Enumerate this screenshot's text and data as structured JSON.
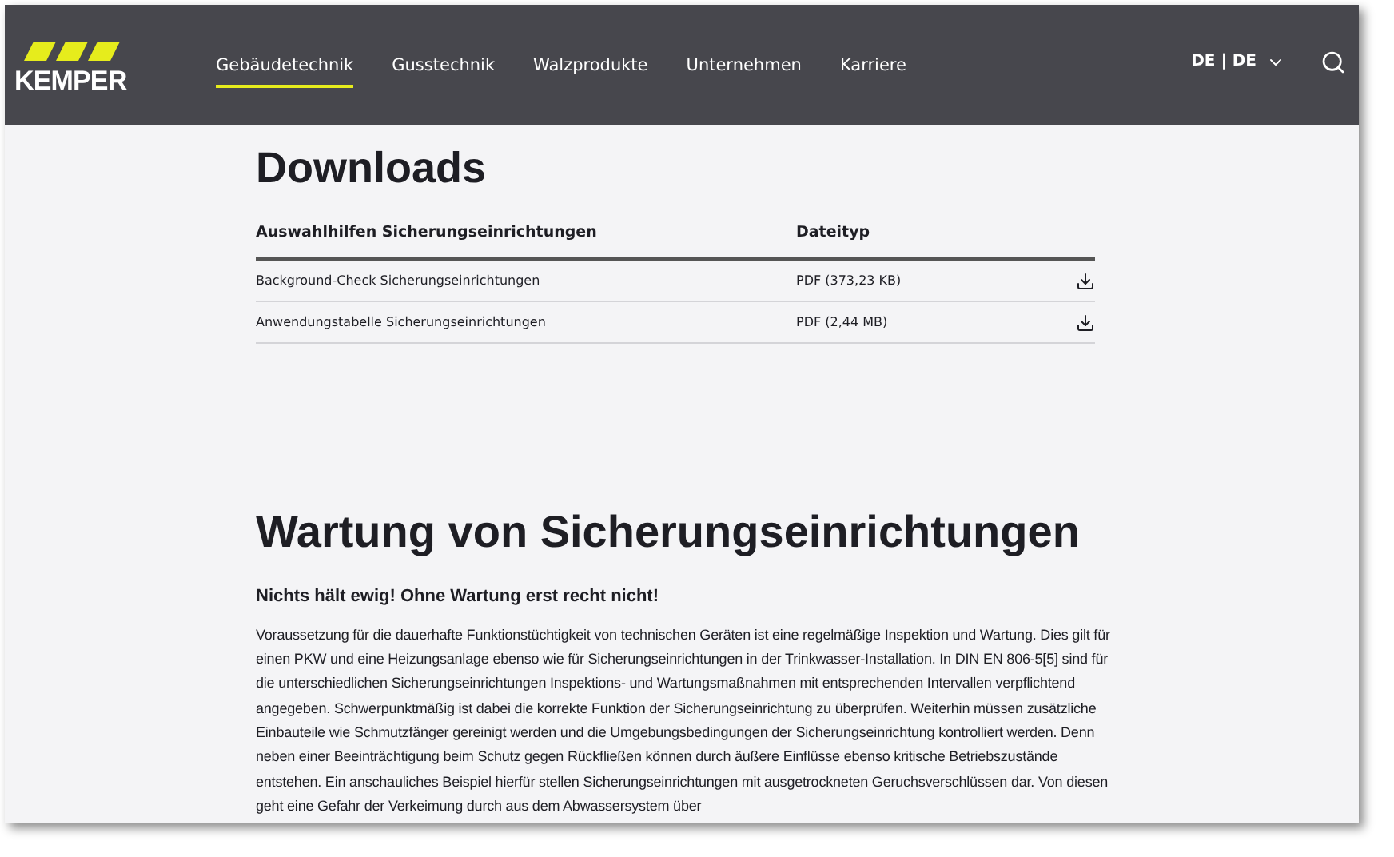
{
  "header": {
    "logo": "KEMPER",
    "nav": [
      {
        "label": "Gebäudetechnik",
        "selected": true
      },
      {
        "label": "Gusstechnik",
        "selected": false
      },
      {
        "label": "Walzprodukte",
        "selected": false
      },
      {
        "label": "Unternehmen",
        "selected": false
      },
      {
        "label": "Karriere",
        "selected": false
      }
    ],
    "language": "DE | DE"
  },
  "downloads": {
    "title": "Downloads",
    "columns": [
      "Auswahlhilfen Sicherungseinrichtungen",
      "Dateityp"
    ],
    "rows": [
      {
        "name": "Background-Check Sicherungseinrichtungen",
        "type": "PDF (373,23 KB)"
      },
      {
        "name": "Anwendungstabelle Sicherungseinrichtungen",
        "type": "PDF (2,44 MB)"
      }
    ]
  },
  "article": {
    "title": "Wartung von Sicherungseinrichtungen",
    "subtitle": "Nichts hält ewig! Ohne Wartung erst recht nicht!",
    "body": "Voraussetzung für die dauerhafte Funktionstüchtigkeit von technischen Geräten ist eine regelmäßige Inspektion und Wartung. Dies gilt für einen PKW und eine Heizungsanlage ebenso wie für Sicherungseinrichtungen in der Trinkwasser-Installation. In DIN EN 806-5[5] sind für die unterschiedlichen Sicherungseinrichtungen Inspektions- und Wartungsmaßnahmen mit entsprechenden Intervallen verpflichtend angegeben. Schwerpunktmäßig ist dabei die korrekte Funktion der Sicherungseinrichtung zu überprüfen. Weiterhin müssen zusätzliche Einbauteile wie Schmutzfänger gereinigt werden und die Umgebungsbedingungen der Sicherungseinrichtung kontrolliert werden. Denn neben einer Beeinträchtigung beim Schutz gegen Rückfließen können durch äußere Einflüsse ebenso kritische Betriebszustände entstehen. Ein anschauliches Beispiel hierfür stellen Sicherungseinrichtungen mit ausgetrockneten Geruchsverschlüssen dar. Von diesen geht eine Gefahr der Verkeimung durch aus dem Abwassersystem über"
  }
}
